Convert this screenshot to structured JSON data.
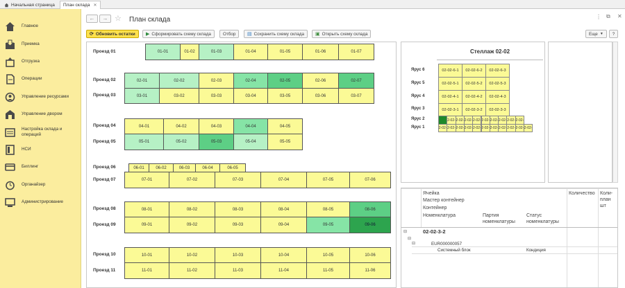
{
  "tabs": [
    {
      "label": "Начальная страница"
    },
    {
      "label": "План склада"
    }
  ],
  "sidebar": {
    "items": [
      {
        "label": "Главное",
        "icon": "home-icon"
      },
      {
        "label": "Приемка",
        "icon": "receiving-icon"
      },
      {
        "label": "Отгрузка",
        "icon": "shipping-icon"
      },
      {
        "label": "Операции",
        "icon": "document-icon"
      },
      {
        "label": "Управление ресурсами",
        "icon": "resources-icon"
      },
      {
        "label": "Управление двором",
        "icon": "yard-icon"
      },
      {
        "label": "Настройка склада и операций",
        "icon": "settings-icon"
      },
      {
        "label": "НСИ",
        "icon": "nsi-icon"
      },
      {
        "label": "Биллинг",
        "icon": "billing-icon"
      },
      {
        "label": "Органайзер",
        "icon": "organizer-icon"
      },
      {
        "label": "Администрирование",
        "icon": "admin-icon"
      }
    ]
  },
  "header": {
    "title": "План склада"
  },
  "toolbar": {
    "refresh": "Обновить остатки",
    "generate": "Сформировать схему склада",
    "select": "Отбор",
    "save": "Сохранить схему склада",
    "open": "Открыть схему склада",
    "more": "Еще",
    "help": "?"
  },
  "colors": {
    "yellow": "#fbfa96",
    "light_green": "#b6f1c5",
    "mid_green": "#86e4a6",
    "green": "#5dcf85",
    "dark_green": "#2da44e",
    "accent": "#ffe14c"
  },
  "passages": [
    {
      "label": "Проезд 01",
      "cells": [
        "01-01",
        "01-02",
        "01-03",
        "01-04",
        "01-05",
        "01-06",
        "01-07"
      ]
    },
    {
      "label": "Проезд 02",
      "cells": [
        "02-01",
        "02-02",
        "02-03",
        "02-04",
        "02-05",
        "02-06",
        "02-07"
      ]
    },
    {
      "label": "Проезд 03",
      "cells": [
        "03-01",
        "03-02",
        "03-03",
        "03-04",
        "03-05",
        "03-06",
        "03-07"
      ]
    },
    {
      "label": "Проезд 04",
      "cells": [
        "04-01",
        "04-02",
        "04-03",
        "04-04",
        "04-05"
      ]
    },
    {
      "label": "Проезд 05",
      "cells": [
        "05-01",
        "05-02",
        "05-03",
        "05-04",
        "05-05"
      ]
    },
    {
      "label": "Проезд 06",
      "cells": [
        "06-01",
        "06-02",
        "06-03",
        "06-04",
        "06-05"
      ]
    },
    {
      "label": "Проезд 07",
      "cells": [
        "07-01",
        "07-02",
        "07-03",
        "07-04",
        "07-05",
        "07-06"
      ]
    },
    {
      "label": "Проезд 08",
      "cells": [
        "08-01",
        "08-02",
        "08-03",
        "08-04",
        "08-05",
        "08-06"
      ]
    },
    {
      "label": "Проезд 09",
      "cells": [
        "09-01",
        "09-02",
        "09-03",
        "09-04",
        "09-05",
        "09-06"
      ]
    },
    {
      "label": "Проезд 10",
      "cells": [
        "10-01",
        "10-02",
        "10-03",
        "10-04",
        "10-05",
        "10-06"
      ]
    },
    {
      "label": "Проезд 11",
      "cells": [
        "11-01",
        "11-02",
        "11-03",
        "11-04",
        "11-05",
        "11-06"
      ]
    }
  ],
  "rack": {
    "title": "Стеллаж 02-02",
    "tiers": [
      {
        "label": "Ярус 6",
        "cells": [
          "02-02-6-1",
          "02-02-6-2",
          "02-02-6-3"
        ]
      },
      {
        "label": "Ярус 5",
        "cells": [
          "02-02-5-1",
          "02-02-5-2",
          "02-02-5-3"
        ]
      },
      {
        "label": "Ярус 4",
        "cells": [
          "02-02-4-1",
          "02-02-4-2",
          "02-02-4-3"
        ]
      },
      {
        "label": "Ярус 3",
        "cells": [
          "02-02-3-1",
          "02-02-3-2",
          "02-02-3-3"
        ]
      },
      {
        "label": "Ярус 2",
        "cells": [
          "",
          "02-02-2",
          "02-02-2",
          "02-02-2",
          "02-02-2",
          "02-02-2",
          "02-02-2",
          "02-02-2",
          "02-02-2",
          "02-02-2"
        ]
      },
      {
        "label": "Ярус 1",
        "cells": [
          "02-02-1",
          "02-02-1",
          "02-02-1",
          "02-02-1",
          "02-02-1",
          "02-02-1",
          "02-02-1",
          "02-02-1",
          "02-02-1",
          "02-02-1",
          "02-02-1"
        ]
      }
    ]
  },
  "tree_table": {
    "headers": {
      "cell": "Ячейка",
      "master_container": "Мастер контейнер",
      "container": "Контейнер",
      "nomenclature": "Номенклатура",
      "batch": "Партия номенклатуры",
      "status": "Статус номенклатуры",
      "quantity": "Количество",
      "quantity_plan": "Коли- план шт"
    },
    "rows": [
      {
        "cell": "02-02-3-2",
        "container": "EUR000000057",
        "item": "Системный блок",
        "status": "Кондиция"
      }
    ]
  }
}
